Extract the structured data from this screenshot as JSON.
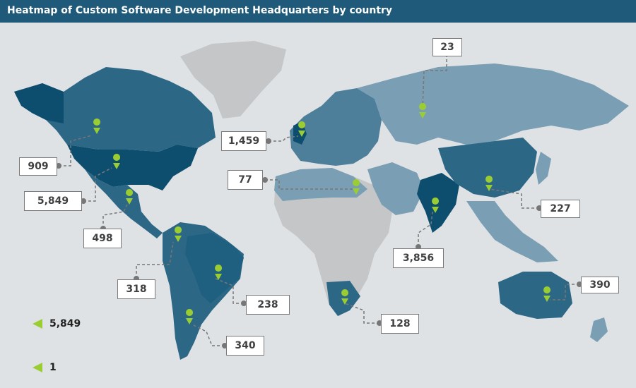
{
  "title": "Heatmap of Custom Software Development Headquarters by country",
  "colors": {
    "title_bg": "#1f5a7a",
    "ocean": "#dfe2e5",
    "no_data": "#c4c6c8",
    "dark": "#0d4e6e",
    "mid": "#2c6786",
    "light": "#7a9eb3",
    "pin": "#9acd32"
  },
  "legend": {
    "max_label": "5,849",
    "min_label": "1"
  },
  "chart_data": {
    "type": "map",
    "title": "Heatmap of Custom Software Development Headquarters by country",
    "scale": {
      "min": 1,
      "max": 5849
    },
    "regions": [
      {
        "label": "909"
      },
      {
        "label": "5,849"
      },
      {
        "label": "498"
      },
      {
        "label": "318"
      },
      {
        "label": "238"
      },
      {
        "label": "340"
      },
      {
        "label": "1,459"
      },
      {
        "label": "77"
      },
      {
        "label": "128"
      },
      {
        "label": "3,856"
      },
      {
        "label": "23"
      },
      {
        "label": "227"
      },
      {
        "label": "390"
      }
    ]
  }
}
